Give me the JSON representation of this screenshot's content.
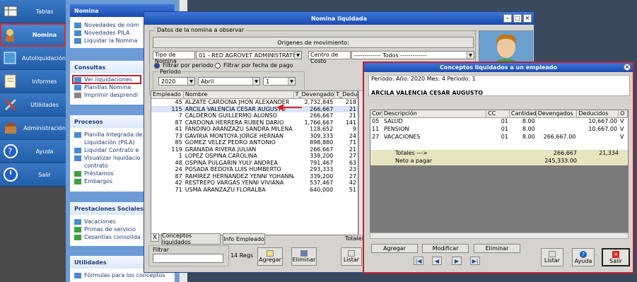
{
  "leftnav": {
    "items": [
      {
        "label": "Tablas",
        "icon": "tables-icon"
      },
      {
        "label": "Nomina",
        "icon": "payroll-icon",
        "active": true
      },
      {
        "label": "Autoliquidación",
        "icon": "autoliquidation-icon"
      },
      {
        "label": "Informes",
        "icon": "reports-icon"
      },
      {
        "label": "Utilidades",
        "icon": "tools-icon"
      },
      {
        "label": "Administración",
        "icon": "admin-icon"
      },
      {
        "label": "Ayuda",
        "icon": "help-icon"
      },
      {
        "label": "Salir",
        "icon": "power-icon"
      }
    ]
  },
  "taskpane": {
    "header": "Nomina",
    "group1": [
      "Novedades de nóm",
      "Novedades PILA",
      "Liquidar la Nomina"
    ],
    "consultas_title": "Consultas",
    "consultas": [
      "Ver liquidaciones",
      "Planillas Nomina",
      "Imprimir desprendi"
    ],
    "procesos_title": "Procesos",
    "procesos": [
      "Planilla Integrada de",
      "Liquidación (PILA)",
      "Liquidar Contrato e",
      "Visualizar liquidacio",
      "contrato",
      "Préstamos",
      "Embargos"
    ],
    "prestaciones_title": "Prestaciones Sociales",
    "prestaciones": [
      "Vacaciones",
      "Primas de servicio",
      "Cesantias consolida"
    ],
    "utilidades_title": "Utilidades",
    "utilidades": [
      "Fórmulas para los conceptos"
    ]
  },
  "nomina": {
    "title": "Nomina liquidada",
    "group_label": "Datos de la nomina a observar",
    "origenes_btn": "Origenes de movimiento:",
    "tipo_label": "Tipo de Nomina",
    "tipo_value": "01 - RED AGROVET ADMINISTRATIVO",
    "centro_label": "Centro de Costo",
    "centro_value": "------------- Todos -------------",
    "radio_periodo": "Filtrar por periodo",
    "radio_fecha": "Filtrar por fecha de pago",
    "periodo_label": "Periodo",
    "year": "2020",
    "month": "Abril",
    "num": "1",
    "columns": [
      "Empleado",
      "Nombre",
      "T_Devengado",
      "T_Deducido"
    ],
    "rows": [
      [
        "45",
        "ALZATE CARDONA JHON ALEXANDER",
        "2,732,845",
        "218"
      ],
      [
        "115",
        "ARCILA VALENCIA CESAR AUGUSTO",
        "266,667",
        "21"
      ],
      [
        "7",
        "CALDERON  GUILLERMO ALONSO",
        "266,667",
        "21"
      ],
      [
        "87",
        "CARDONA HERRERA RUBEN DARIO",
        "1,766,667",
        "141"
      ],
      [
        "41",
        "FANDIÑO ARANZAZU SANDRA MILENA",
        "118,652",
        "9"
      ],
      [
        "73",
        "GAVIRIA MONTOYA JORGE HERNAN",
        "309,333",
        "24"
      ],
      [
        "85",
        "GOMEZ VELEZ PEDRO ANTONIO",
        "898,880",
        "71"
      ],
      [
        "119",
        "GRANADA RIVERA JULIAN",
        "266,667",
        "21"
      ],
      [
        "1",
        "LOPEZ OSPINA CAROLINA",
        "339,200",
        "27"
      ],
      [
        "48",
        "OSPINA PULGARIN YULY ANDREA",
        "791,467",
        "63"
      ],
      [
        "24",
        "POSADA BEDOYA LUIS HUMBERTO",
        "293,333",
        "23"
      ],
      [
        "87",
        "RAMIREZ HERNANDEZ YENNI YOHANNA",
        "339,200",
        "27"
      ],
      [
        "42",
        "RESTREPO VARGAS YENNI VIVIANA",
        "537,467",
        "42"
      ],
      [
        "71",
        "USMA ARANZAZU FLORALBA",
        "640,000",
        "51"
      ]
    ],
    "tab_conceptos": "Conceptos liquidados",
    "tab_info": "Info Empleado",
    "totales": "Totales",
    "filtrar_label": "Filtrar",
    "regs": "14 Regs",
    "agregar": "Agregar",
    "eliminar": "Eliminar",
    "listar": "Listar"
  },
  "conceptos": {
    "title": "Conceptos liquidados a un empleado",
    "periodo_text": "Periodo:  Año: 2020  Mes: 4  Periodo: 1",
    "employee": "ARCILA VALENCIA CESAR AUGUSTO",
    "columns": [
      "Con",
      "Descripción",
      "CC",
      "Cantidad",
      "Devengados",
      "Deducidos",
      "O"
    ],
    "rows": [
      [
        "05",
        "SALUD",
        "01",
        "8.00",
        "",
        "10,667.00",
        "V"
      ],
      [
        "11",
        "PENSION",
        "01",
        "8.00",
        "",
        "10,667.00",
        "V"
      ],
      [
        "27",
        "VACACIONES",
        "01",
        "8.00",
        "266,667.00",
        "",
        "V"
      ]
    ],
    "totales_label": "Totales  --->",
    "tot_dev": "266,667",
    "tot_ded": "21,334",
    "neto_label": "Neto a pagar",
    "neto": "245,333.00",
    "agregar": "Agregar",
    "modificar": "Modificar",
    "eliminar": "Eliminar",
    "listar": "Listar",
    "ayuda": "Ayuda",
    "salir": "Salir"
  },
  "colors": {
    "nav": "#2a5a9c",
    "title": "#1a4ab0",
    "highlight": "#c02030",
    "totals": "#e8e4c0"
  }
}
